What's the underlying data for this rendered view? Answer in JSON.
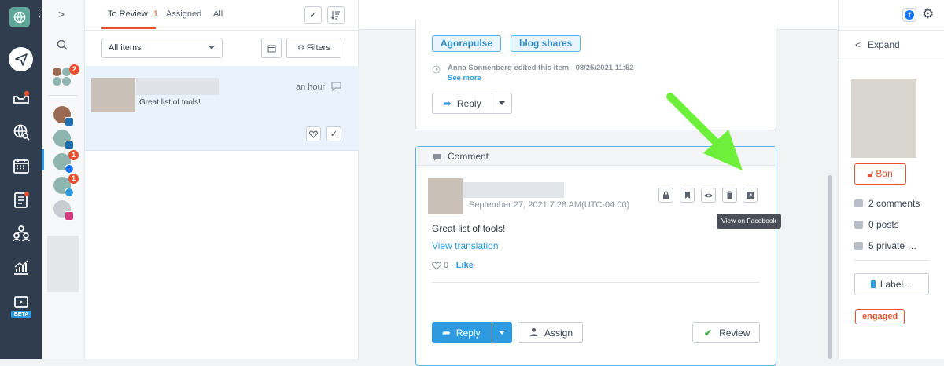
{
  "nav": {
    "beta_label": "BETA"
  },
  "profiles": {
    "badge_group": "2",
    "badge_facebook": "1",
    "badge_twitter": "1"
  },
  "list": {
    "tabs": [
      {
        "label": "To Review",
        "count": "1"
      },
      {
        "label": "Assigned"
      },
      {
        "label": "All"
      }
    ],
    "filter_select": "All items",
    "filters_button": "Filters",
    "item": {
      "time": "an hour",
      "text": "Great list of tools!"
    }
  },
  "feed": {
    "top_card": {
      "tags": [
        "Agorapulse",
        "blog shares"
      ],
      "history": "Anna Sonnenberg edited this item - 08/25/2021 11:52",
      "see_more": "See more",
      "reply_label": "Reply"
    },
    "comment_card": {
      "header": "Comment",
      "date": "September 27, 2021 7:28 AM(UTC-04:00)",
      "text": "Great list of tools!",
      "translation": "View translation",
      "likes": "0",
      "like_label": "Like",
      "tooltip": "View on Facebook",
      "reply_label": "Reply",
      "assign_label": "Assign",
      "review_label": "Review"
    }
  },
  "right": {
    "expand": "Expand",
    "ban": "Ban",
    "comments": "2 comments",
    "posts": "0 posts",
    "private": "5 private …",
    "label_button": "Label…",
    "engaged": "engaged"
  },
  "colors": {
    "accent": "#2e9be0",
    "nav_bg": "#2f3d4f",
    "danger": "#e8502f",
    "arrow": "#6ef03a"
  }
}
